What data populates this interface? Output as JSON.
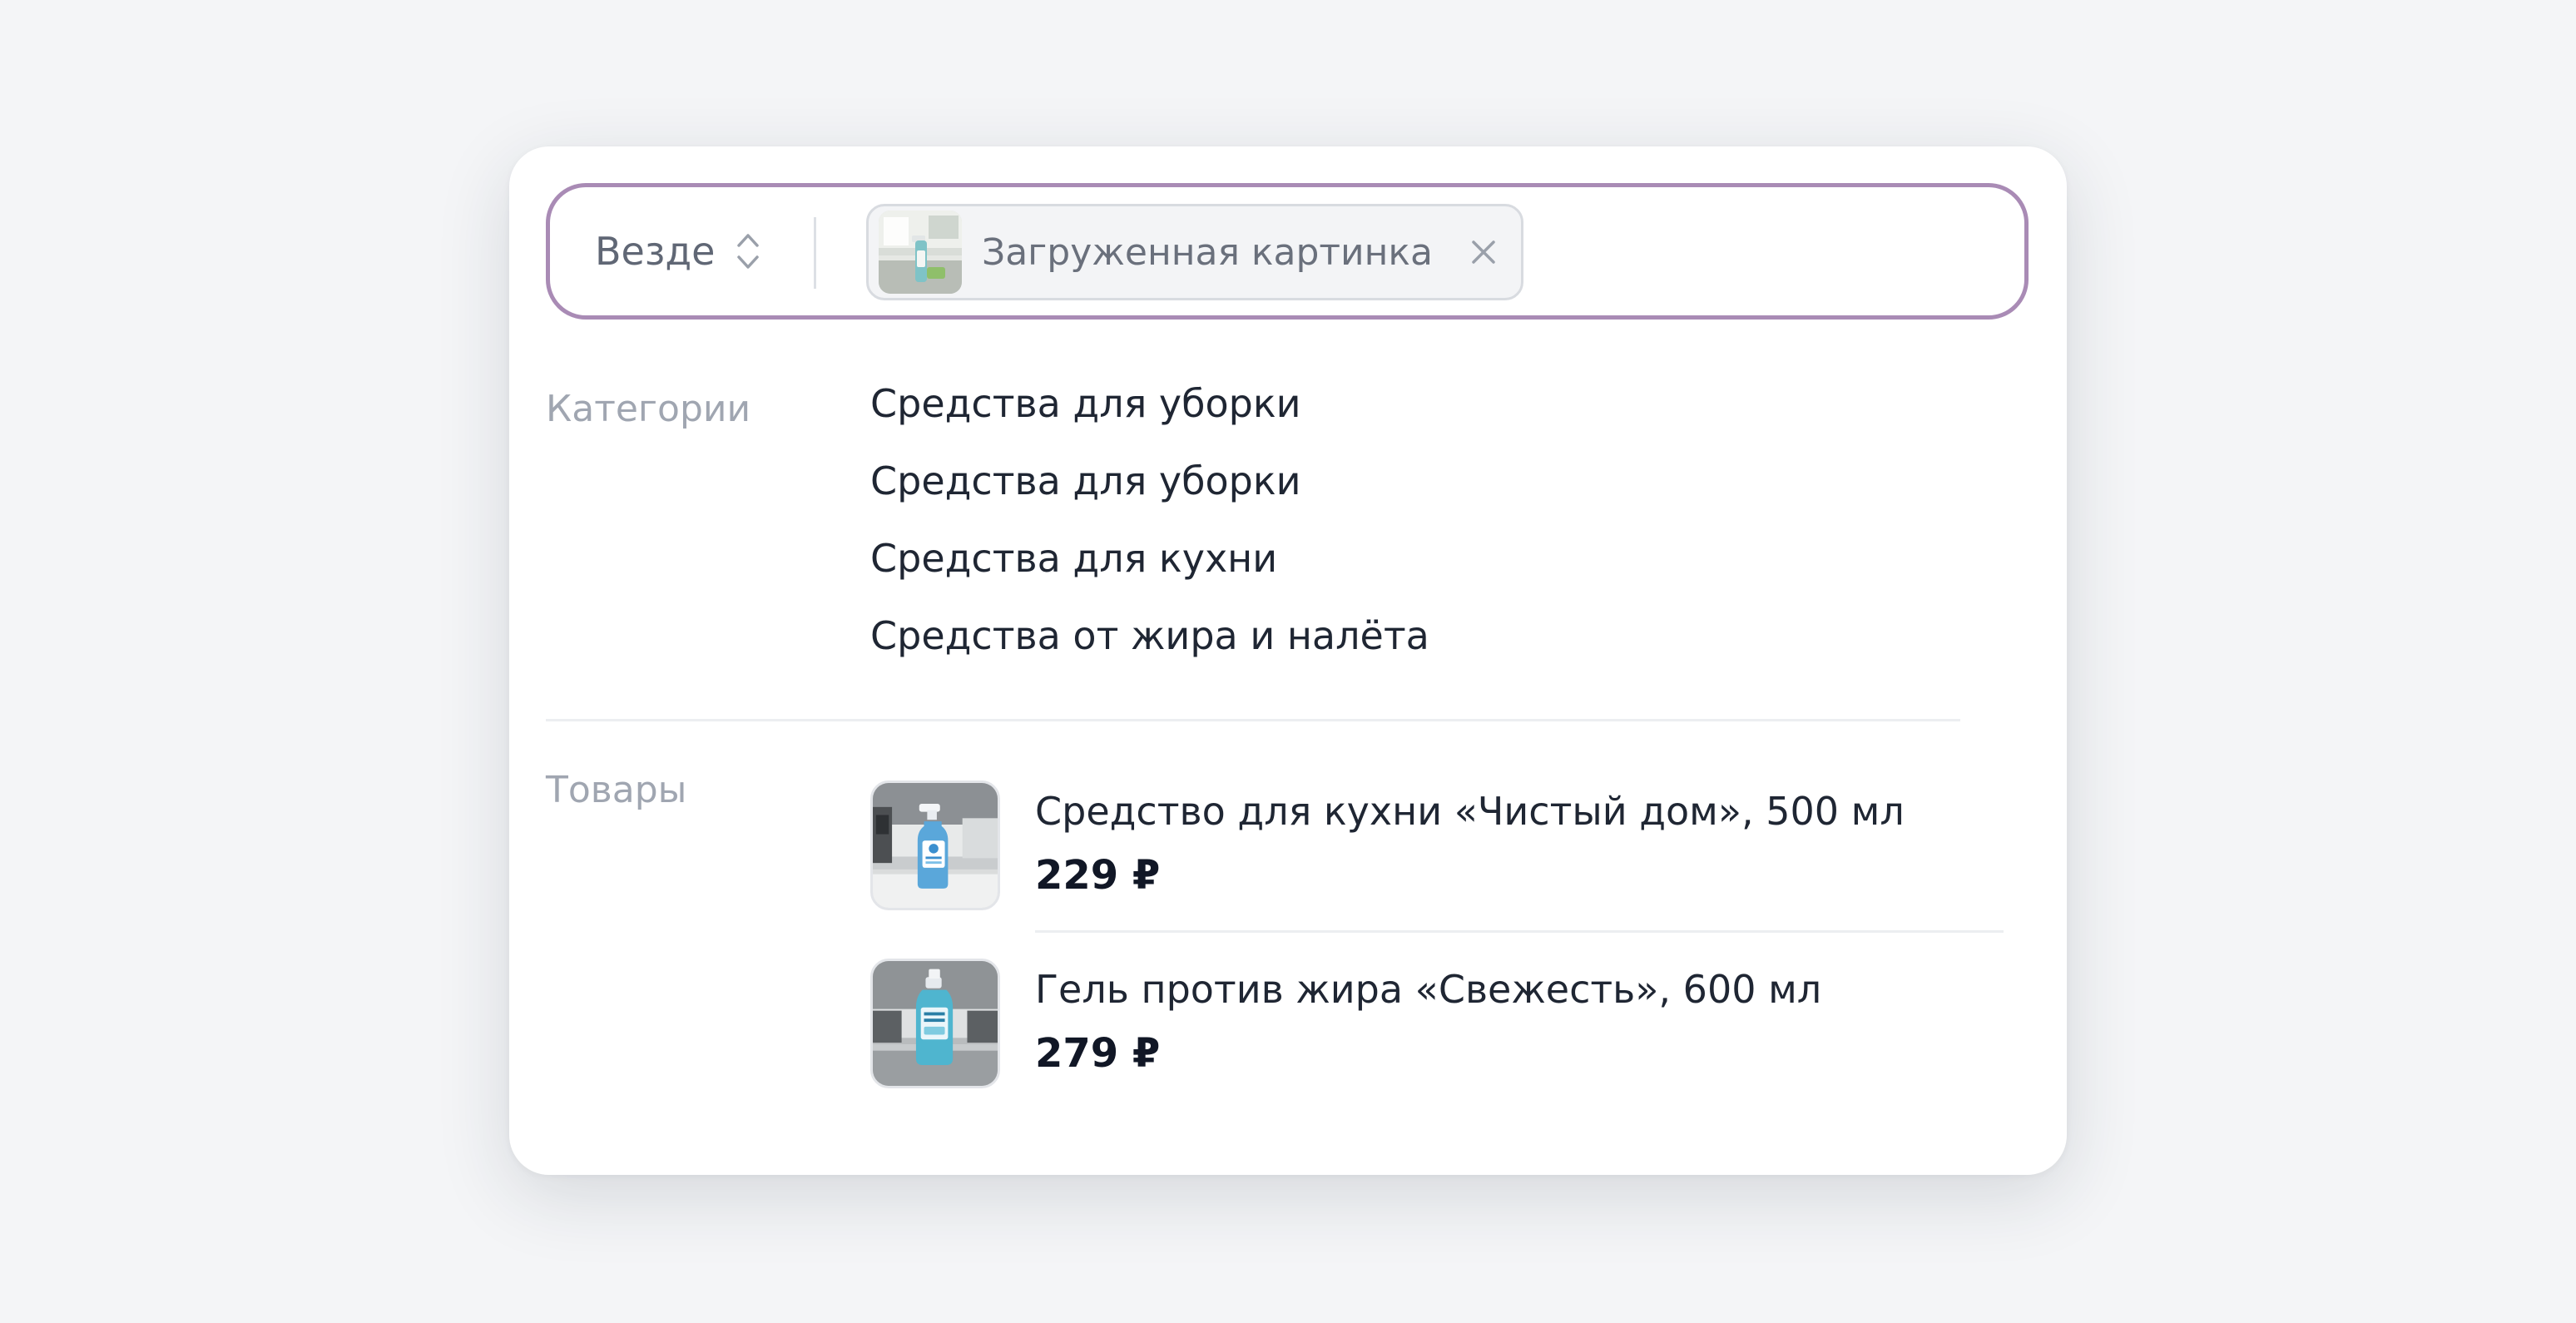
{
  "search": {
    "scope_label": "Везде",
    "chip_label": "Загруженная картинка"
  },
  "categories": {
    "heading": "Категории",
    "items": [
      "Средства для уборки",
      "Средства для уборки",
      "Средства для кухни",
      "Средства от жира и налёта"
    ]
  },
  "products": {
    "heading": "Товары",
    "items": [
      {
        "name": "Средство для кухни «Чистый дом», 500 мл",
        "price": "229 ₽"
      },
      {
        "name": "Гель против жира «Свежесть», 600 мл",
        "price": "279 ₽"
      }
    ]
  },
  "colors": {
    "focus_border": "#a98bb5",
    "text_primary": "#1f2633",
    "text_muted": "#a0a6b1"
  }
}
